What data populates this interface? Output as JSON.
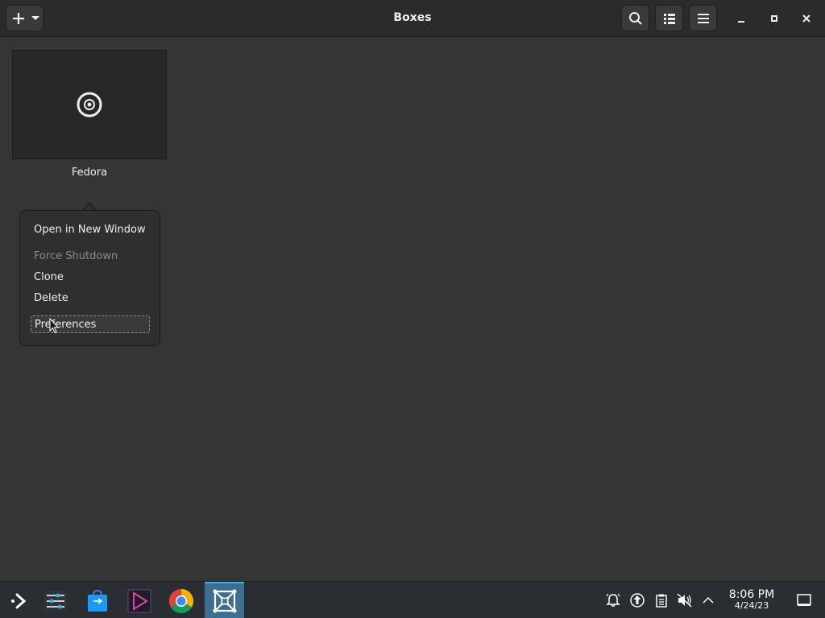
{
  "window": {
    "title": "Boxes",
    "new_button_icon": "plus-icon",
    "search_icon": "search-icon",
    "view_icon": "list-view-icon",
    "menu_icon": "hamburger-menu-icon"
  },
  "boxes": [
    {
      "name": "Fedora",
      "thumbnail_icon": "target-icon"
    }
  ],
  "context_menu": {
    "items": [
      {
        "label": "Open in New Window",
        "enabled": true
      },
      {
        "label": "Force Shutdown",
        "enabled": false
      },
      {
        "label": "Clone",
        "enabled": true
      },
      {
        "label": "Delete",
        "enabled": true
      },
      {
        "label": "Preferences",
        "enabled": true,
        "focused": true
      }
    ]
  },
  "taskbar": {
    "apps": [
      "application-launcher-icon",
      "settings-sliders-icon",
      "discover-store-icon",
      "media-player-icon",
      "chrome-icon",
      "boxes-icon"
    ],
    "active_app": "boxes-icon",
    "tray": [
      "notifications-icon",
      "update-icon",
      "clipboard-icon",
      "volume-muted-icon",
      "expand-tray-icon"
    ],
    "clock": {
      "time": "8:06 PM",
      "date": "4/24/23"
    },
    "show_desktop_icon": "show-desktop-icon"
  },
  "colors": {
    "background": "#353535",
    "headerbar": "#2b2b2b",
    "taskbar": "#2a2e32",
    "active_task": "#3d6f93",
    "accent": "#3daee9"
  }
}
